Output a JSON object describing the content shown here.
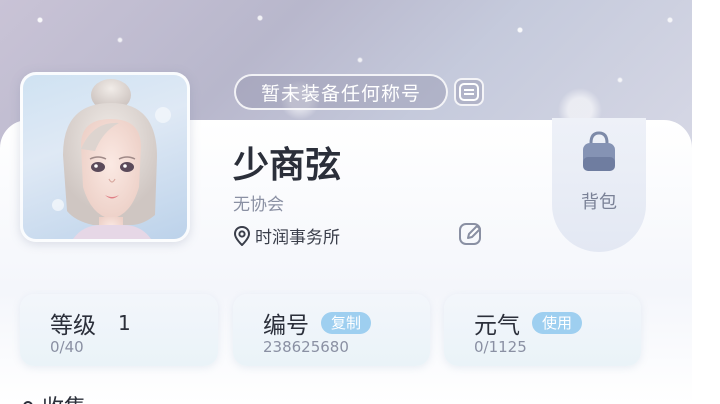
{
  "profile": {
    "title_pill": "暂未装备任何称号",
    "name": "少商弦",
    "guild": "无协会",
    "location": "时润事务所"
  },
  "bag": {
    "label": "背包"
  },
  "stats": {
    "level": {
      "label": "等级",
      "value": "1",
      "progress": "0/40"
    },
    "id": {
      "label": "编号",
      "action": "复制",
      "value": "238625680"
    },
    "energy": {
      "label": "元气",
      "action": "使用",
      "value": "0/1125"
    }
  },
  "section": {
    "label": "收集"
  },
  "icons": {
    "title_switch": "title-switch-icon",
    "location": "location-pin-icon",
    "edit": "edit-pencil-icon",
    "bag": "bag-icon",
    "section": "section-bullet-icon"
  },
  "colors": {
    "chip": "#9ecff0",
    "name": "#2b2f3a",
    "muted": "#8a90a3"
  }
}
